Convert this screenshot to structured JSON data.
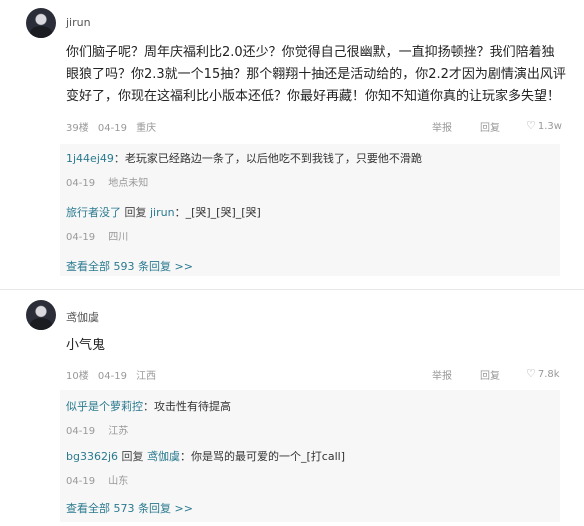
{
  "comments": [
    {
      "username": "jirun",
      "content": "你们脑子呢？周年庆福利比2.0还少？你觉得自己很幽默，一直抑扬顿挫？我们陪着独眼狼了吗？你2.3就一个15抽？那个翱翔十抽还是活动给的，你2.2才因为剧情演出风评变好了，你现在这福利比小版本还低？你最好再藏！你知不知道你真的让玩家多失望！",
      "floor": "39楼",
      "date": "04-19",
      "location": "重庆",
      "report_label": "举报",
      "reply_label": "回复",
      "likes": "1.3w",
      "replies": [
        {
          "user": "1j44ej49",
          "sep": "：",
          "reply_to": "",
          "text": "老玩家已经路边一条了，以后他吃不到我钱了，只要他不滑跪",
          "date": "04-19",
          "location": "地点未知"
        },
        {
          "user": "旅行者没了",
          "sep": " 回复 ",
          "reply_to": "jirun",
          "text": "：_[哭]_[哭]_[哭]",
          "date": "04-19",
          "location": "四川"
        }
      ],
      "view_all": "查看全部 593 条回复 >>"
    },
    {
      "username": "鸢伽虞",
      "content": "小气鬼",
      "floor": "10楼",
      "date": "04-19",
      "location": "江西",
      "report_label": "举报",
      "reply_label": "回复",
      "likes": "7.8k",
      "replies": [
        {
          "user": "似乎是个萝莉控",
          "sep": "：",
          "reply_to": "",
          "text": "攻击性有待提高",
          "date": "04-19",
          "location": "江苏"
        },
        {
          "user": "bg3362j6",
          "sep": " 回复 ",
          "reply_to": "鸢伽虞",
          "text": "：你是骂的最可爱的一个_[打call]",
          "date": "04-19",
          "location": "山东"
        }
      ],
      "view_all": "查看全部 573 条回复 >>"
    }
  ]
}
